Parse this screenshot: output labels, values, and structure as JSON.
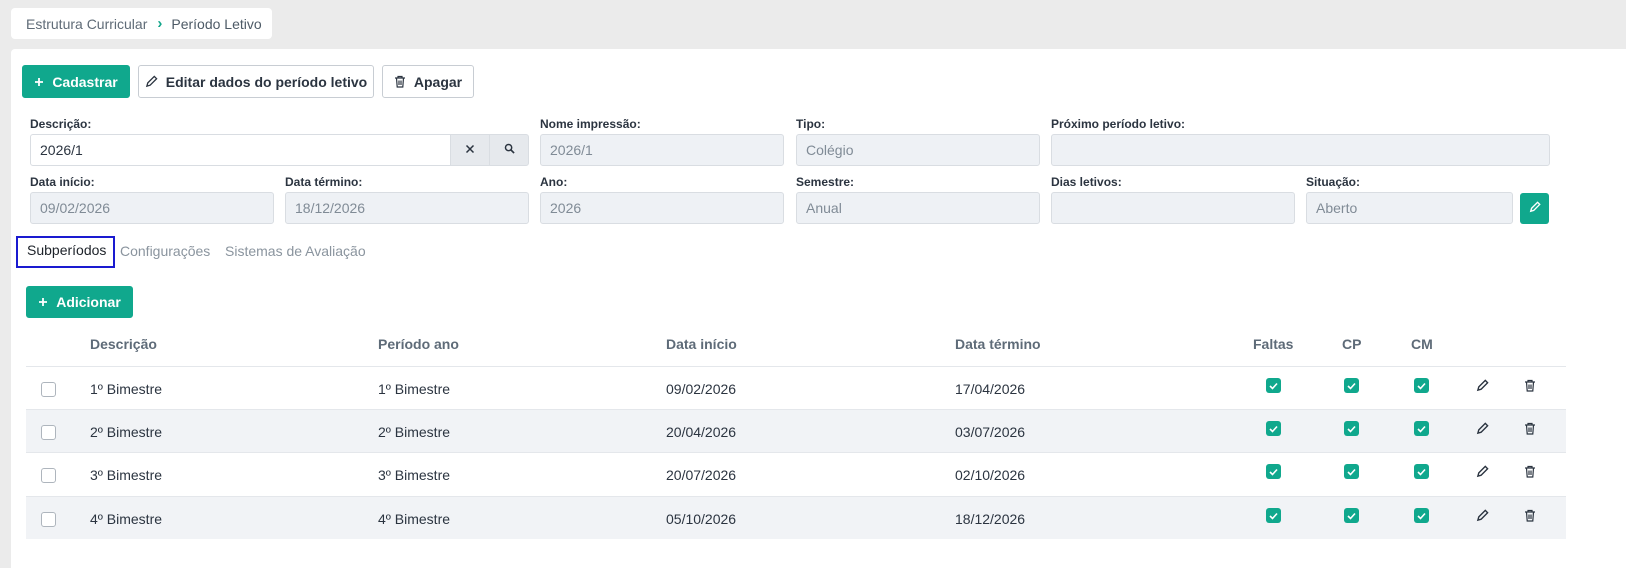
{
  "breadcrumb": {
    "items": [
      "Estrutura Curricular",
      "Período Letivo"
    ]
  },
  "toolbar": {
    "cadastrar_label": "Cadastrar",
    "editar_label": "Editar dados do período letivo",
    "apagar_label": "Apagar"
  },
  "form": {
    "descricao": {
      "label": "Descrição:",
      "value": "2026/1"
    },
    "nome_impressao": {
      "label": "Nome impressão:",
      "value": "2026/1"
    },
    "tipo": {
      "label": "Tipo:",
      "value": "Colégio"
    },
    "proximo_periodo": {
      "label": "Próximo período letivo:",
      "value": ""
    },
    "data_inicio": {
      "label": "Data início:",
      "value": "09/02/2026"
    },
    "data_termino": {
      "label": "Data término:",
      "value": "18/12/2026"
    },
    "ano": {
      "label": "Ano:",
      "value": "2026"
    },
    "semestre": {
      "label": "Semestre:",
      "value": "Anual"
    },
    "dias_letivos": {
      "label": "Dias letivos:",
      "value": ""
    },
    "situacao": {
      "label": "Situação:",
      "value": "Aberto"
    }
  },
  "tabs": [
    {
      "label": "Subperíodos",
      "active": true
    },
    {
      "label": "Configurações",
      "active": false
    },
    {
      "label": "Sistemas de Avaliação",
      "active": false
    }
  ],
  "subperiodos": {
    "add_label": "Adicionar",
    "columns": [
      "Descrição",
      "Período ano",
      "Data início",
      "Data término",
      "Faltas",
      "CP",
      "CM"
    ],
    "rows": [
      {
        "descricao": "1º Bimestre",
        "periodo_ano": "1º Bimestre",
        "data_inicio": "09/02/2026",
        "data_termino": "17/04/2026",
        "faltas": true,
        "cp": true,
        "cm": true
      },
      {
        "descricao": "2º Bimestre",
        "periodo_ano": "2º Bimestre",
        "data_inicio": "20/04/2026",
        "data_termino": "03/07/2026",
        "faltas": true,
        "cp": true,
        "cm": true
      },
      {
        "descricao": "3º Bimestre",
        "periodo_ano": "3º Bimestre",
        "data_inicio": "20/07/2026",
        "data_termino": "02/10/2026",
        "faltas": true,
        "cp": true,
        "cm": true
      },
      {
        "descricao": "4º Bimestre",
        "periodo_ano": "4º Bimestre",
        "data_inicio": "05/10/2026",
        "data_termino": "18/12/2026",
        "faltas": true,
        "cp": true,
        "cm": true
      }
    ]
  },
  "colors": {
    "accent": "#10a88d",
    "focus_outline": "#1a1ad0",
    "row_alt": "#f1f3f6"
  }
}
